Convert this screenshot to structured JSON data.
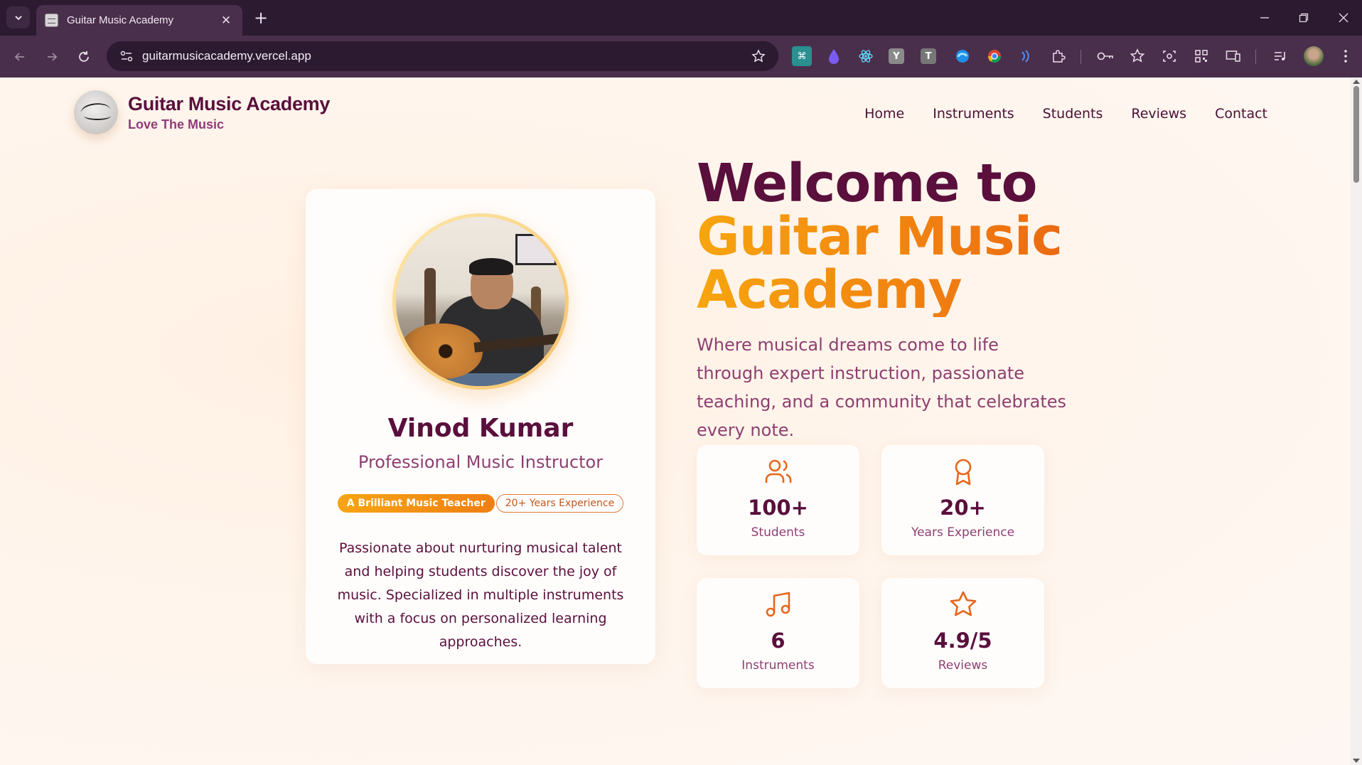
{
  "browser": {
    "tab_title": "Guitar Music Academy",
    "url": "guitarmusicacademy.vercel.app",
    "extensions": [
      "ai-icon",
      "drop-icon",
      "react-icon",
      "y-icon",
      "t-icon",
      "edge-icon",
      "chrome-icon",
      "wifi-icon",
      "puzzle-icon",
      "key-icon",
      "favorites-icon",
      "screenshot-icon",
      "qr-icon",
      "devices-icon",
      "media-icon",
      "profile-avatar"
    ]
  },
  "brand": {
    "name": "Guitar Music Academy",
    "tagline": "Love The Music"
  },
  "nav": {
    "items": [
      "Home",
      "Instruments",
      "Students",
      "Reviews",
      "Contact"
    ]
  },
  "profile": {
    "name": "Vinod Kumar",
    "role": "Professional Music Instructor",
    "badge_primary": "A Brilliant Music Teacher",
    "badge_secondary": "20+ Years Experience",
    "bio": "Passionate about nurturing musical talent and helping students discover the joy of music. Specialized in multiple instruments with a focus on personalized learning approaches."
  },
  "hero": {
    "title_line1": "Welcome to",
    "title_line2": "Guitar Music",
    "title_line3": "Academy",
    "subtitle": "Where musical dreams come to life through expert instruction, passionate teaching, and a community that celebrates every note."
  },
  "stats": [
    {
      "icon": "users-icon",
      "value": "100+",
      "label": "Students"
    },
    {
      "icon": "award-icon",
      "value": "20+",
      "label": "Years Experience"
    },
    {
      "icon": "music-note-icon",
      "value": "6",
      "label": "Instruments"
    },
    {
      "icon": "star-icon",
      "value": "4.9/5",
      "label": "Reviews"
    }
  ],
  "colors": {
    "primary": "#5a0f3c",
    "secondary": "#8e3f70",
    "accent_start": "#f7a50e",
    "accent_end": "#ec6a12",
    "browser_frame": "#4a2f4c"
  }
}
